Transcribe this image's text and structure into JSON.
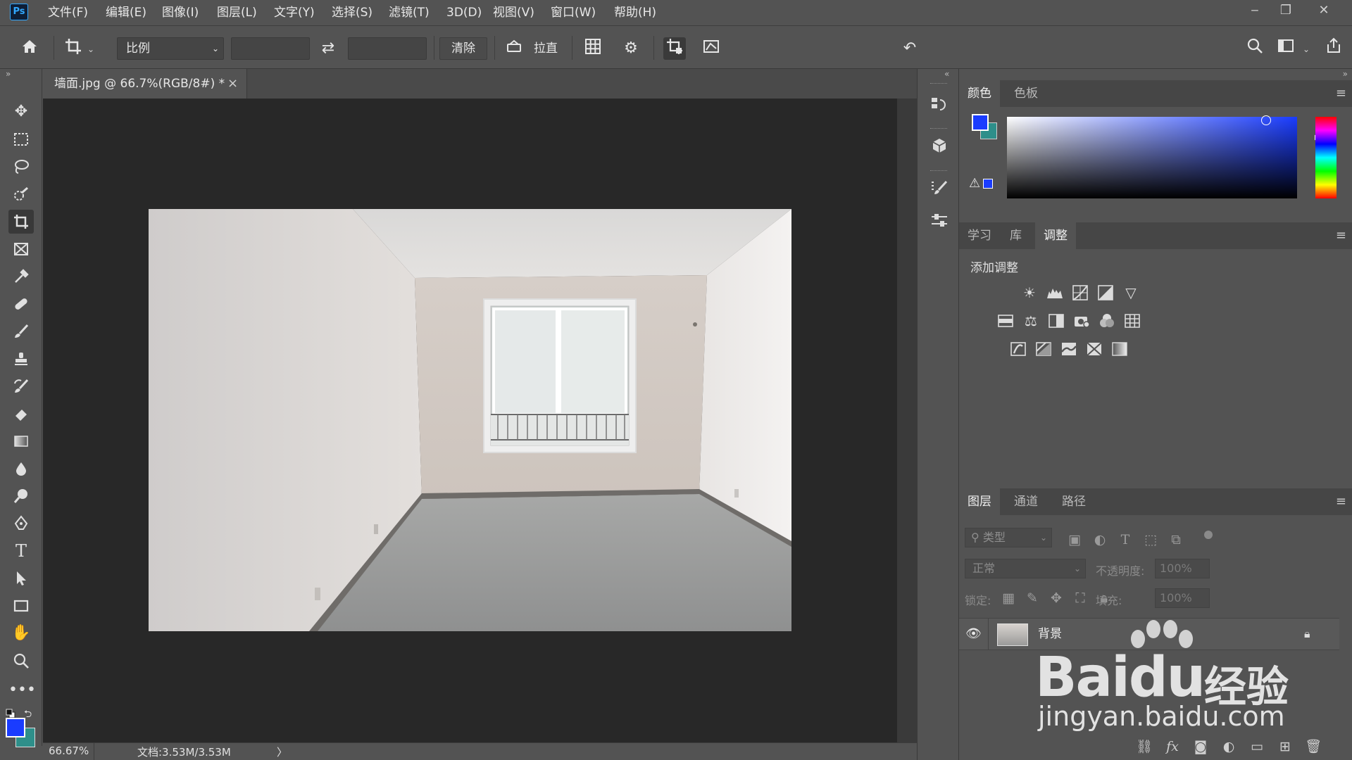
{
  "app": {
    "logo": "Ps"
  },
  "menu": [
    {
      "label": "文件(F)"
    },
    {
      "label": "编辑(E)"
    },
    {
      "label": "图像(I)"
    },
    {
      "label": "图层(L)"
    },
    {
      "label": "文字(Y)"
    },
    {
      "label": "选择(S)"
    },
    {
      "label": "滤镜(T)"
    },
    {
      "label": "3D(D)"
    },
    {
      "label": "视图(V)"
    },
    {
      "label": "窗口(W)"
    },
    {
      "label": "帮助(H)"
    }
  ],
  "window_buttons": {
    "minimize": "‒",
    "restore": "❐",
    "close": "✕"
  },
  "options": {
    "ratio_label": "比例",
    "width_value": "",
    "height_value": "",
    "clear_label": "清除",
    "straighten_label": "拉直"
  },
  "document": {
    "tab_title": "墙面.jpg @ 66.7%(RGB/8#) *",
    "tab_close": "×",
    "zoom": "66.67%",
    "doc_info": "文档:3.53M/3.53M",
    "status_arrow": "〉"
  },
  "color_panel": {
    "tabs": [
      "颜色",
      "色板"
    ],
    "foreground": "#1a3cff",
    "background": "#2e8f8a"
  },
  "adjust_panel": {
    "tabs": [
      "学习",
      "库",
      "调整"
    ],
    "heading": "添加调整"
  },
  "layers_panel": {
    "tabs": [
      "图层",
      "通道",
      "路径"
    ],
    "filter_placeholder": "类型",
    "blend_mode": "正常",
    "opacity_label": "不透明度:",
    "opacity_value": "100%",
    "lock_label": "锁定:",
    "fill_label": "填充:",
    "fill_value": "100%",
    "layers": [
      {
        "name": "背景",
        "visible": true,
        "locked": true
      }
    ]
  },
  "watermark": {
    "brand": "Baidu",
    "brand_cn": "经验",
    "url": "jingyan.baidu.com"
  },
  "colors": {
    "accent_blue": "#31a8ff",
    "panel_bg": "#535353",
    "canvas_bg": "#282828"
  }
}
